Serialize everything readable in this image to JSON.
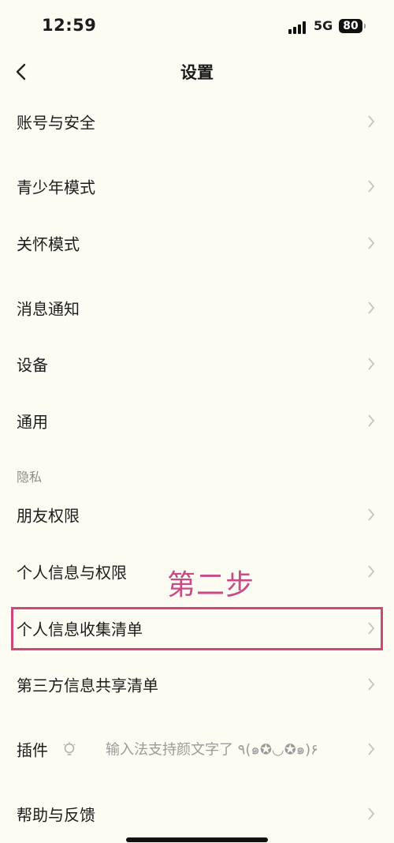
{
  "status_bar": {
    "time": "12:59",
    "network": "5G",
    "battery": "80"
  },
  "nav": {
    "title": "设置"
  },
  "rows": [
    {
      "label": "账号与安全"
    },
    {
      "label": "青少年模式"
    },
    {
      "label": "关怀模式"
    },
    {
      "label": "消息通知"
    },
    {
      "label": "设备"
    },
    {
      "label": "通用"
    },
    {
      "label": "朋友权限"
    },
    {
      "label": "个人信息与权限"
    },
    {
      "label": "个人信息收集清单"
    },
    {
      "label": "第三方信息共享清单"
    },
    {
      "label": "插件",
      "status": "输入法支持颜文字了 ٩(๑✪◡✪๑)۶",
      "icon": "lightbulb-icon"
    },
    {
      "label": "帮助与反馈"
    }
  ],
  "section": {
    "privacy": "隐私"
  },
  "annotation": {
    "text": "第二步",
    "color": "#c94a86"
  },
  "colors": {
    "background": "#fdfcf3",
    "highlight": "#d04678",
    "chevron": "#c4c4c4"
  }
}
